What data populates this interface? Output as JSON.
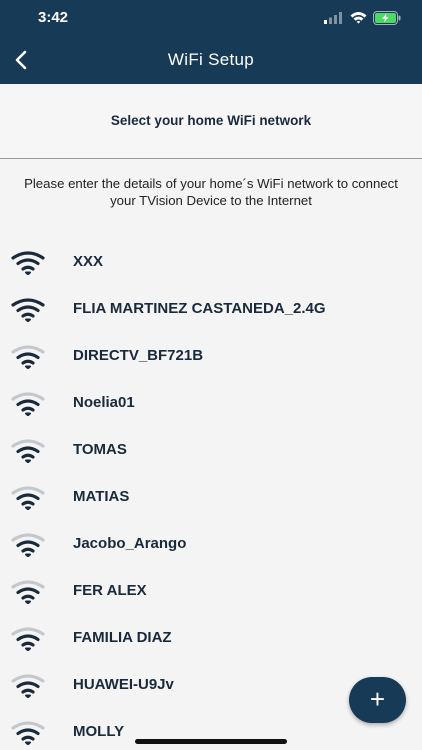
{
  "status_bar": {
    "time": "3:42"
  },
  "header": {
    "title": "WiFi Setup"
  },
  "subheader": {
    "text": "Select your home WiFi network"
  },
  "instructions": "Please enter the details of your home´s WiFi network to connect your TVision Device to the Internet",
  "networks": [
    {
      "name": "XXX",
      "signal": "strong"
    },
    {
      "name": "FLIA MARTINEZ CASTANEDA_2.4G",
      "signal": "strong"
    },
    {
      "name": "DIRECTV_BF721B",
      "signal": "weak"
    },
    {
      "name": "Noelia01",
      "signal": "weak"
    },
    {
      "name": "TOMAS",
      "signal": "weak"
    },
    {
      "name": "MATIAS",
      "signal": "weak"
    },
    {
      "name": "Jacobo_Arango",
      "signal": "weak"
    },
    {
      "name": "FER ALEX",
      "signal": "weak"
    },
    {
      "name": "FAMILIA DIAZ",
      "signal": "weak"
    },
    {
      "name": "HUAWEI-U9Jv",
      "signal": "weak"
    },
    {
      "name": "MOLLY",
      "signal": "weak"
    }
  ],
  "fab": {
    "icon": "plus-icon",
    "label": "+"
  },
  "colors": {
    "header_bg": "#173a56",
    "text_dark": "#1a2a3a",
    "background": "#f4f4f4"
  }
}
